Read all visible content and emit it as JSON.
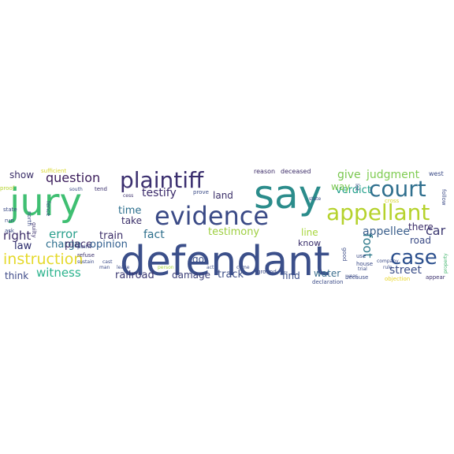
{
  "title": "",
  "words": [
    {
      "id": "defendant",
      "text": "defendant",
      "color": "#3b4f8a"
    },
    {
      "id": "say",
      "text": "say",
      "color": "#2b8c8b"
    },
    {
      "id": "jury",
      "text": "jury",
      "color": "#3fbf72"
    },
    {
      "id": "evidence",
      "text": "evidence",
      "color": "#3a4a86"
    },
    {
      "id": "plaintiff",
      "text": "plaintiff",
      "color": "#3b2f6f"
    },
    {
      "id": "court",
      "text": "court",
      "color": "#2f6f8e"
    },
    {
      "id": "appellant",
      "text": "appellant",
      "color": "#b5d22c"
    },
    {
      "id": "case",
      "text": "case",
      "color": "#2b4f8d"
    },
    {
      "id": "instruction",
      "text": "instruction",
      "color": "#e5d92b"
    },
    {
      "id": "question",
      "text": "question",
      "color": "#3a1c5a"
    },
    {
      "id": "witness",
      "text": "witness",
      "color": "#2bb38d"
    },
    {
      "id": "error",
      "text": "error",
      "color": "#2a9f8c"
    },
    {
      "id": "testimony",
      "text": "testimony",
      "color": "#9ecf41"
    },
    {
      "id": "fact",
      "text": "fact",
      "color": "#2e6f8c"
    },
    {
      "id": "time",
      "text": "time",
      "color": "#2b6e8d"
    },
    {
      "id": "testify",
      "text": "testify",
      "color": "#3a2a6a"
    },
    {
      "id": "verdict",
      "text": "verdict",
      "color": "#1f9e89"
    },
    {
      "id": "give",
      "text": "give",
      "color": "#7ac74f"
    },
    {
      "id": "judgment",
      "text": "judgment",
      "color": "#7fcc52"
    },
    {
      "id": "appellee",
      "text": "appellee",
      "color": "#3b5f8c"
    },
    {
      "id": "car",
      "text": "car",
      "color": "#3b3770"
    },
    {
      "id": "street",
      "text": "street",
      "color": "#3a4d88"
    },
    {
      "id": "foot",
      "text": "foot",
      "color": "#2f7a8b"
    },
    {
      "id": "right",
      "text": "right",
      "color": "#3b2c67"
    },
    {
      "id": "train",
      "text": "train",
      "color": "#3a2c67"
    },
    {
      "id": "law",
      "text": "law",
      "color": "#2b2c6c"
    },
    {
      "id": "charge",
      "text": "charge",
      "color": "#2b6d8d"
    },
    {
      "id": "place",
      "text": "place",
      "color": "#3a2a66"
    },
    {
      "id": "opinion",
      "text": "opinion",
      "color": "#2e5c8d"
    },
    {
      "id": "railroad",
      "text": "railroad",
      "color": "#3b3872"
    },
    {
      "id": "damage",
      "text": "damage",
      "color": "#3c3f78"
    },
    {
      "id": "track",
      "text": "track",
      "color": "#3b4d86"
    },
    {
      "id": "take",
      "text": "take",
      "color": "#3a2e69"
    },
    {
      "id": "land",
      "text": "land",
      "color": "#3a2e68"
    },
    {
      "id": "show",
      "text": "show",
      "color": "#3a2e68"
    },
    {
      "id": "think",
      "text": "think",
      "color": "#3e4a88"
    },
    {
      "id": "find",
      "text": "find",
      "color": "#3b4f8a"
    },
    {
      "id": "water",
      "text": "water",
      "color": "#3d6f8e"
    },
    {
      "id": "line",
      "text": "line",
      "color": "#a8d63d"
    },
    {
      "id": "know",
      "text": "know",
      "color": "#3a2f6c"
    },
    {
      "id": "there",
      "text": "there",
      "color": "#3b2d68"
    },
    {
      "id": "road",
      "text": "road",
      "color": "#3a4a85"
    },
    {
      "id": "way",
      "text": "way",
      "color": "#7ac74f"
    },
    {
      "id": "go",
      "text": "go",
      "color": "#3a4f8a"
    },
    {
      "id": "deceased",
      "text": "deceased",
      "color": "#3a2a66"
    },
    {
      "id": "reason",
      "text": "reason",
      "color": "#3a2a66"
    },
    {
      "id": "west",
      "text": "west",
      "color": "#3a4a86"
    },
    {
      "id": "sufficient",
      "text": "sufficient",
      "color": "#d8d72b"
    },
    {
      "id": "prove",
      "text": "prove",
      "color": "#3a4a86"
    },
    {
      "id": "person",
      "text": "person",
      "color": "#a8d63d"
    },
    {
      "id": "come",
      "text": "come",
      "color": "#3a4a86"
    },
    {
      "id": "act",
      "text": "act",
      "color": "#3a4a86"
    },
    {
      "id": "ground",
      "text": "ground",
      "color": "#3a4a86"
    },
    {
      "id": "declaration",
      "text": "declaration",
      "color": "#3a4a86"
    },
    {
      "id": "because",
      "text": "because",
      "color": "#3a4a86"
    },
    {
      "id": "objection",
      "text": "objection",
      "color": "#e8d51f"
    },
    {
      "id": "appear",
      "text": "appear",
      "color": "#3a2f6c"
    },
    {
      "id": "rule",
      "text": "rule",
      "color": "#3a4a86"
    },
    {
      "id": "company",
      "text": "company",
      "color": "#3a4a86"
    },
    {
      "id": "property",
      "text": "property",
      "color": "#4bb873"
    },
    {
      "id": "follow",
      "text": "follow",
      "color": "#3a4a86"
    },
    {
      "id": "good",
      "text": "good",
      "color": "#3a4a86"
    },
    {
      "id": "house",
      "text": "house",
      "color": "#3a4a86"
    },
    {
      "id": "use",
      "text": "use",
      "color": "#3a4a86"
    },
    {
      "id": "proof",
      "text": "proof",
      "color": "#b5d22c"
    },
    {
      "id": "fence",
      "text": "fence",
      "color": "#3a4a86"
    },
    {
      "id": "north",
      "text": "north",
      "color": "#3a4a86"
    },
    {
      "id": "guilty",
      "text": "guilty",
      "color": "#3a2f6c"
    },
    {
      "id": "state",
      "text": "state",
      "color": "#3a4a86"
    },
    {
      "id": "run",
      "text": "run",
      "color": "#3a4a86"
    },
    {
      "id": "ask",
      "text": "ask",
      "color": "#3a4a86"
    },
    {
      "id": "point",
      "text": "point",
      "color": "#3a4a86"
    },
    {
      "id": "refuse",
      "text": "refuse",
      "color": "#3a2f6c"
    },
    {
      "id": "south",
      "text": "south",
      "color": "#3a4a86"
    },
    {
      "id": "tend",
      "text": "tend",
      "color": "#3a2f6c"
    },
    {
      "id": "cess",
      "text": "cess",
      "color": "#3a2f6c"
    },
    {
      "id": "cast",
      "text": "cast",
      "color": "#3a4a86"
    },
    {
      "id": "sustain",
      "text": "sustain",
      "color": "#3a4a86"
    },
    {
      "id": "man",
      "text": "man",
      "color": "#3a4a86"
    },
    {
      "id": "leave",
      "text": "leave",
      "color": "#3a4a86"
    },
    {
      "id": "year",
      "text": "year",
      "color": "#3a4a86"
    },
    {
      "id": "trial",
      "text": "trial",
      "color": "#3a4a86"
    },
    {
      "id": "cross",
      "text": "cross",
      "color": "#d8d72b"
    },
    {
      "id": "lot",
      "text": "lot",
      "color": "#3a4a86"
    },
    {
      "id": "state2",
      "text": "state",
      "color": "#3a4a86"
    }
  ]
}
